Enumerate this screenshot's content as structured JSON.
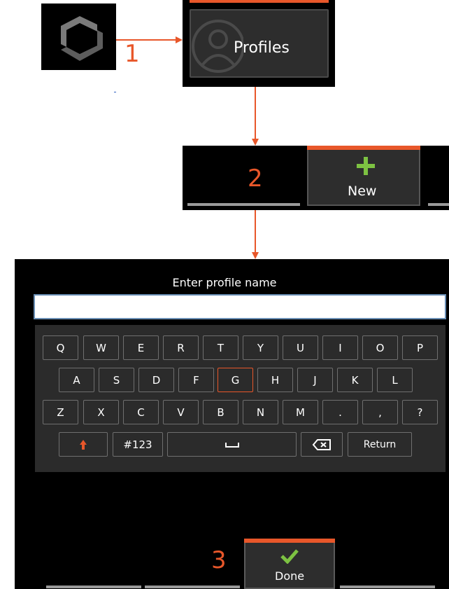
{
  "steps": {
    "one": "1",
    "two": "2",
    "three": "3"
  },
  "profiles_tile": {
    "label": "Profiles",
    "icon": "user-avatar-icon"
  },
  "app_icon": "app-logo-icon",
  "new_tab": {
    "label": "New",
    "icon": "plus-icon"
  },
  "keyboard_screen": {
    "title": "Enter profile name",
    "input_value": "",
    "selected_key": "G",
    "rows": [
      [
        "Q",
        "W",
        "E",
        "R",
        "T",
        "Y",
        "U",
        "I",
        "O",
        "P"
      ],
      [
        "A",
        "S",
        "D",
        "F",
        "G",
        "H",
        "J",
        "K",
        "L"
      ],
      [
        "Z",
        "X",
        "C",
        "V",
        "B",
        "N",
        "M",
        ".",
        ",",
        "?"
      ]
    ],
    "bottom_row": {
      "shift_icon": "shift-up-arrow-icon",
      "symbols": "#123",
      "space_icon": "space-bar-icon",
      "backspace_icon": "backspace-icon",
      "return": "Return"
    }
  },
  "done_button": {
    "label": "Done",
    "icon": "checkmark-icon"
  },
  "colors": {
    "accent_orange": "#e8572a",
    "plus_green": "#7dc242",
    "check_green": "#7dc242",
    "panel_dark": "#2d2d2d"
  }
}
